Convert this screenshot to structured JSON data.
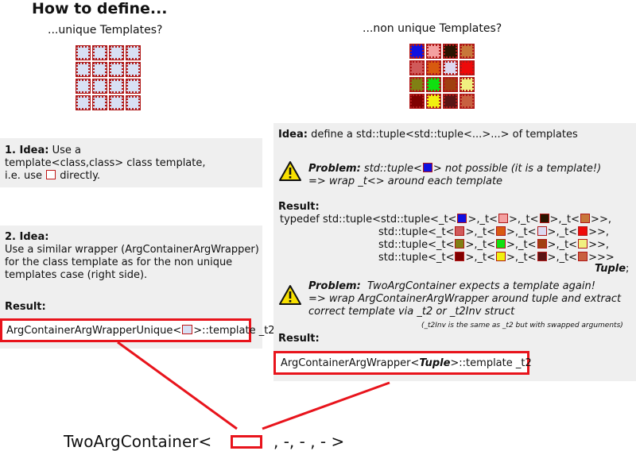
{
  "title": "How to define...",
  "left": {
    "subtitle": "...unique Templates?",
    "cell_color": "#d8e0f4",
    "idea1": {
      "heading": "1. Idea:",
      "text1": " Use a",
      "text2": "template<class,class> class template,",
      "text3a": "i.e. use ",
      "text3b": " directly."
    },
    "idea2": {
      "heading": "2. Idea:",
      "lines": [
        "Use a similar wrapper (ArgContainerArgWrapper)",
        "for the class template as for the non unique",
        "templates case (right side)."
      ],
      "result_label": "Result:",
      "result_pre": "ArgContainerArgWrapperUnique<",
      "result_post": ">::template _t2"
    }
  },
  "right": {
    "subtitle": "...non unique Templates?",
    "grid_colors": [
      [
        "#1010e0",
        "#f4a0a0",
        "#2a1400",
        "#c8763a"
      ],
      [
        "#d05a5a",
        "#d85a10",
        "#dcd8f0",
        "#ee0a0a"
      ],
      [
        "#808014",
        "#10e010",
        "#a04010",
        "#f0f080"
      ],
      [
        "#800000",
        "#f0f010",
        "#5a1414",
        "#c86040"
      ]
    ],
    "idea": {
      "heading": "Idea:",
      "text": " define a std::tuple<std::tuple<...>...> of templates"
    },
    "problem1": {
      "label": "Problem:",
      "text_pre": " std::tuple<",
      "text_post": "> not possible (it is a template!)",
      "line2": "=> wrap _t<> around each template"
    },
    "result": {
      "label": "Result:",
      "line_prefix": "typedef std::tuple<std::tuple<",
      "tuple_label": "Tuple",
      "tuple_suffix": ";"
    },
    "problem2": {
      "label": "Problem:",
      "line1": "  TwoArgContainer expects a template again!",
      "line2": "=> wrap ArgContainerArgWrapper around tuple and extract",
      "line3": "correct template via _t2 or _t2Inv struct",
      "note": "(_t2Inv is the same as _t2 but with swapped arguments)"
    },
    "result2": {
      "label": "Result:",
      "pre": "ArgContainerArgWrapper<",
      "bold": "Tuple",
      "post": ">::template _t2"
    }
  },
  "bottom": {
    "pre": "TwoArgContainer<",
    "post": ", -, - , - >"
  }
}
